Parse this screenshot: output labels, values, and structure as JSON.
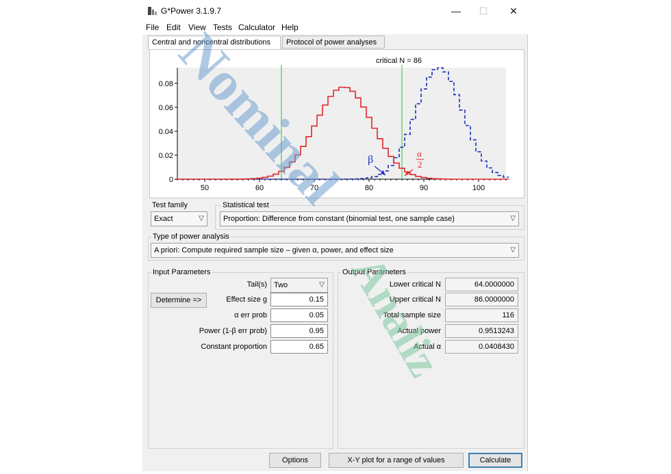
{
  "window": {
    "title": "G*Power 3.1.9.7",
    "controls": {
      "minimize": "—",
      "maximize": "☐",
      "close": "✕"
    }
  },
  "menu": [
    "File",
    "Edit",
    "View",
    "Tests",
    "Calculator",
    "Help"
  ],
  "tabs": [
    {
      "label": "Central and noncentral distributions",
      "active": true
    },
    {
      "label": "Protocol of power analyses",
      "active": false
    }
  ],
  "plot": {
    "critical_label": "critical N = 86",
    "beta_label": "β",
    "alpha_num": "α",
    "alpha_den": "2",
    "x_ticks": [
      "50",
      "60",
      "70",
      "80",
      "90",
      "100"
    ],
    "y_ticks": [
      "0",
      "0.02",
      "0.04",
      "0.06",
      "0.08"
    ],
    "x_range": [
      45,
      105
    ],
    "y_range": [
      0,
      0.093
    ],
    "critical_lower": 64,
    "critical_upper": 86,
    "h0_mean": 75.4,
    "h0_sd": 5.14,
    "h0_peak": 0.077,
    "h1_mean": 92.8,
    "h1_sd": 4.3,
    "h1_peak": 0.093,
    "colors": {
      "h0": "#e0262a",
      "h1": "#1a2fb8",
      "critical": "#3fd24a"
    }
  },
  "test_family": {
    "label": "Test family",
    "value": "Exact"
  },
  "statistical_test": {
    "label": "Statistical test",
    "value": "Proportion: Difference from constant (binomial test, one sample case)"
  },
  "power_analysis": {
    "label": "Type of power analysis",
    "value": "A priori: Compute required sample size – given α, power, and effect size"
  },
  "input": {
    "label": "Input Parameters",
    "determine_button": "Determine =>",
    "tails": {
      "label": "Tail(s)",
      "value": "Two"
    },
    "effect_size": {
      "label": "Effect size g",
      "value": "0.15"
    },
    "alpha": {
      "label": "α err prob",
      "value": "0.05"
    },
    "power": {
      "label": "Power (1-β err prob)",
      "value": "0.95"
    },
    "constant": {
      "label": "Constant proportion",
      "value": "0.65"
    }
  },
  "output": {
    "label": "Output Parameters",
    "lower_n": {
      "label": "Lower critical N",
      "value": "64.0000000"
    },
    "upper_n": {
      "label": "Upper critical N",
      "value": "86.0000000"
    },
    "total": {
      "label": "Total sample size",
      "value": "116"
    },
    "actual_power": {
      "label": "Actual power",
      "value": "0.9513243"
    },
    "actual_alpha": {
      "label": "Actual α",
      "value": "0.0408430"
    }
  },
  "buttons": {
    "options": "Options",
    "xy_plot": "X-Y plot for a range of values",
    "calculate": "Calculate"
  },
  "watermark": {
    "word1": "Nominal",
    "word2": "Analiz",
    "color1": "#6f9fcf",
    "color2": "#7ec9a0"
  }
}
